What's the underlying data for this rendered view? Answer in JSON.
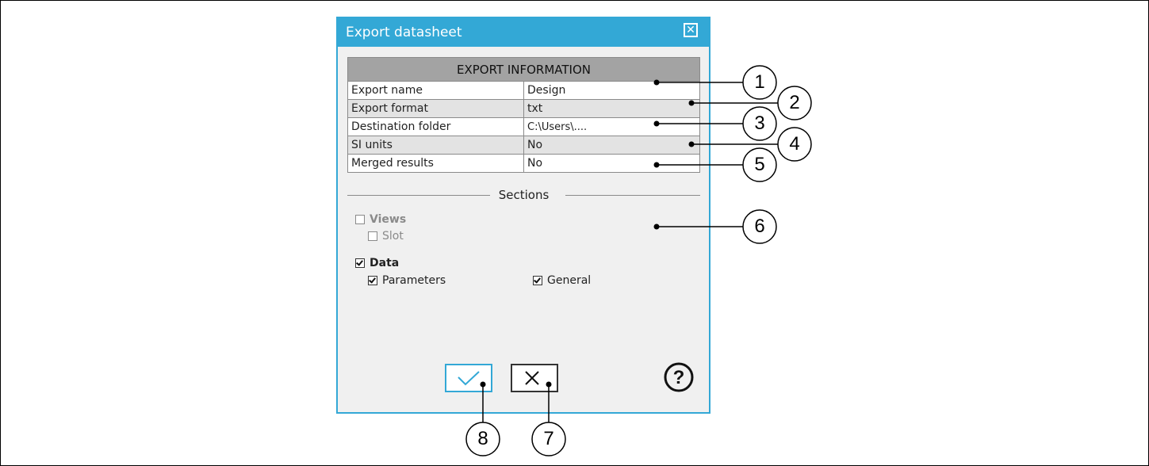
{
  "dialog": {
    "title": "Export datasheet",
    "close_icon": "close-icon"
  },
  "export_info": {
    "header": "EXPORT INFORMATION",
    "rows": [
      {
        "key": "Export name",
        "value": "Design"
      },
      {
        "key": "Export format",
        "value": "txt"
      },
      {
        "key": "Destination folder",
        "value": "C:\\Users\\...."
      },
      {
        "key": "SI units",
        "value": "No"
      },
      {
        "key": "Merged results",
        "value": "No"
      }
    ]
  },
  "sections": {
    "title": "Sections",
    "views": {
      "label": "Views",
      "checked": false,
      "disabled": true
    },
    "slot": {
      "label": "Slot",
      "checked": false,
      "disabled": true
    },
    "data": {
      "label": "Data",
      "checked": true
    },
    "parameters": {
      "label": "Parameters",
      "checked": true
    },
    "general": {
      "label": "General",
      "checked": true
    }
  },
  "buttons": {
    "ok_icon": "checkmark-icon",
    "cancel_icon": "cross-icon",
    "help_icon": "help-icon"
  },
  "callouts": [
    "1",
    "2",
    "3",
    "4",
    "5",
    "6",
    "7",
    "8"
  ],
  "colors": {
    "accent": "#33a8d6",
    "table_header": "#a3a3a3"
  }
}
